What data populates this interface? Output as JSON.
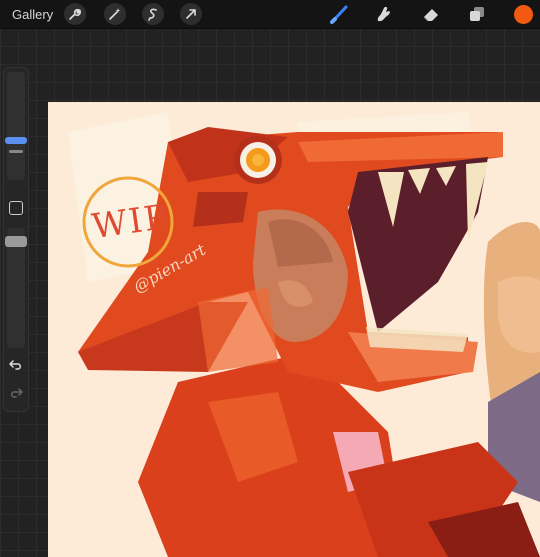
{
  "topbar": {
    "gallery_label": "Gallery",
    "tools_left": [
      "wrench-icon",
      "magic-wand-icon",
      "selection-icon",
      "transform-arrow-icon"
    ],
    "tools_right": [
      "brush-icon",
      "smudge-icon",
      "eraser-icon",
      "layers-icon"
    ],
    "active_tool": "brush-icon",
    "accent_color": "#3b82f6",
    "current_color": "#f25a12"
  },
  "sidebar": {
    "brush_size_icon": "size-slider",
    "modify_icon": "square-icon",
    "opacity_icon": "opacity-slider",
    "undo_icon": "undo-arrow-icon",
    "redo_icon": "redo-arrow-icon"
  },
  "canvas": {
    "artwork_subject": "artwork",
    "wip_text": "WIP",
    "watermark_text": "@pien-art",
    "colors": {
      "background": "#fdebd8",
      "primary_red": "#e14a1f",
      "dark_red": "#b5301a",
      "light_orange": "#f58a4b",
      "tooth": "#f4e4c2",
      "skin": "#c97d5a",
      "wip_circle": "#f0a63a",
      "wip_letters": "#e04a32"
    }
  }
}
